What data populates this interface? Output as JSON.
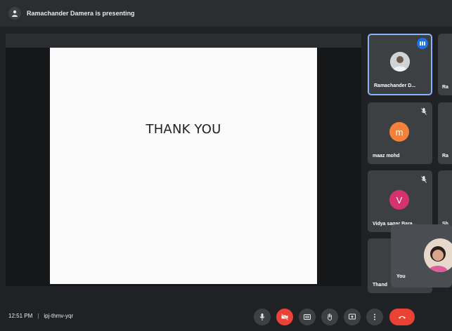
{
  "topbar": {
    "presenting_text": "Ramachander Damera is presenting",
    "icon": "presenter-icon"
  },
  "slide": {
    "title": "THANK YOU"
  },
  "participants": [
    {
      "name": "Ramachander D...",
      "avatar": "photo",
      "active": true,
      "badge": "speaking-indicator"
    },
    {
      "name": "maaz mohd",
      "avatar_letter": "m",
      "avatar_color": "#f4803a",
      "muted": true
    },
    {
      "name": "Vidya sagar Bara...",
      "avatar_letter": "V",
      "avatar_color": "#d6336c",
      "muted": true
    },
    {
      "name": "Thand",
      "muted": false
    }
  ],
  "cut_off_tiles": [
    "Ra",
    "Ra",
    "Sh"
  ],
  "self_view": {
    "label": "You"
  },
  "bottombar": {
    "time": "12:51 PM",
    "meeting_code": "ipj-thmv-yqr",
    "controls": [
      {
        "name": "mic-icon",
        "red": false
      },
      {
        "name": "camera-off-icon",
        "red": true
      },
      {
        "name": "captions-icon",
        "red": false
      },
      {
        "name": "raise-hand-icon",
        "red": false
      },
      {
        "name": "present-icon",
        "red": false
      },
      {
        "name": "more-options-icon",
        "red": false
      },
      {
        "name": "end-call-icon",
        "red": true
      }
    ]
  },
  "colors": {
    "accent": "#8ab4f8",
    "end_call": "#ea4335",
    "tile": "#3c4043"
  }
}
